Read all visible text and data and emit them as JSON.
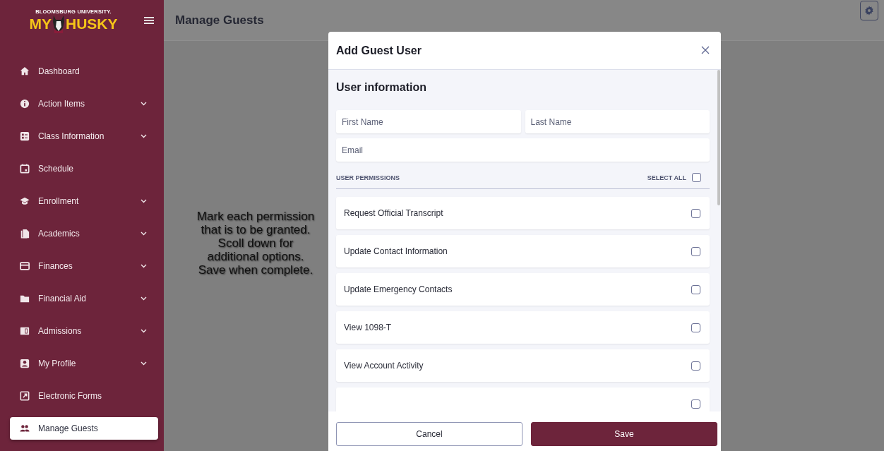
{
  "sidebar": {
    "logo": {
      "university": "BLOOMSBURG UNIVERSITY.",
      "left": "MY",
      "right": "HUSKY"
    },
    "items": [
      {
        "label": "Dashboard",
        "has_submenu": false,
        "selected": false
      },
      {
        "label": "Action Items",
        "has_submenu": true,
        "selected": false
      },
      {
        "label": "Class Information",
        "has_submenu": true,
        "selected": false
      },
      {
        "label": "Schedule",
        "has_submenu": false,
        "selected": false
      },
      {
        "label": "Enrollment",
        "has_submenu": true,
        "selected": false
      },
      {
        "label": "Academics",
        "has_submenu": true,
        "selected": false
      },
      {
        "label": "Finances",
        "has_submenu": true,
        "selected": false
      },
      {
        "label": "Financial Aid",
        "has_submenu": true,
        "selected": false
      },
      {
        "label": "Admissions",
        "has_submenu": true,
        "selected": false
      },
      {
        "label": "My Profile",
        "has_submenu": true,
        "selected": false
      },
      {
        "label": "Electronic Forms",
        "has_submenu": false,
        "selected": false
      },
      {
        "label": "Manage Guests",
        "has_submenu": false,
        "selected": true
      }
    ]
  },
  "header": {
    "title": "Manage Guests"
  },
  "annotation": "Mark each permission that is to be granted.  Scoll down for additional options.  Save when complete.",
  "dialog": {
    "title": "Add Guest User",
    "section": "User information",
    "fields": [
      {
        "placeholder": "First Name"
      },
      {
        "placeholder": "Last Name"
      },
      {
        "placeholder": "Email"
      }
    ],
    "permissions_heading": "USER PERMISSIONS",
    "select_all": {
      "label": "SELECT ALL",
      "checked": false
    },
    "permissions": [
      {
        "label": "Request Official Transcript",
        "checked": false
      },
      {
        "label": "Update Contact Information",
        "checked": false
      },
      {
        "label": "Update Emergency Contacts",
        "checked": false
      },
      {
        "label": "View 1098-T",
        "checked": false
      },
      {
        "label": "View Account Activity",
        "checked": false
      },
      {
        "checked": false
      }
    ],
    "buttons": [
      {
        "label": "Cancel",
        "kind": "secondary"
      },
      {
        "label": "Save",
        "kind": "primary"
      }
    ]
  }
}
